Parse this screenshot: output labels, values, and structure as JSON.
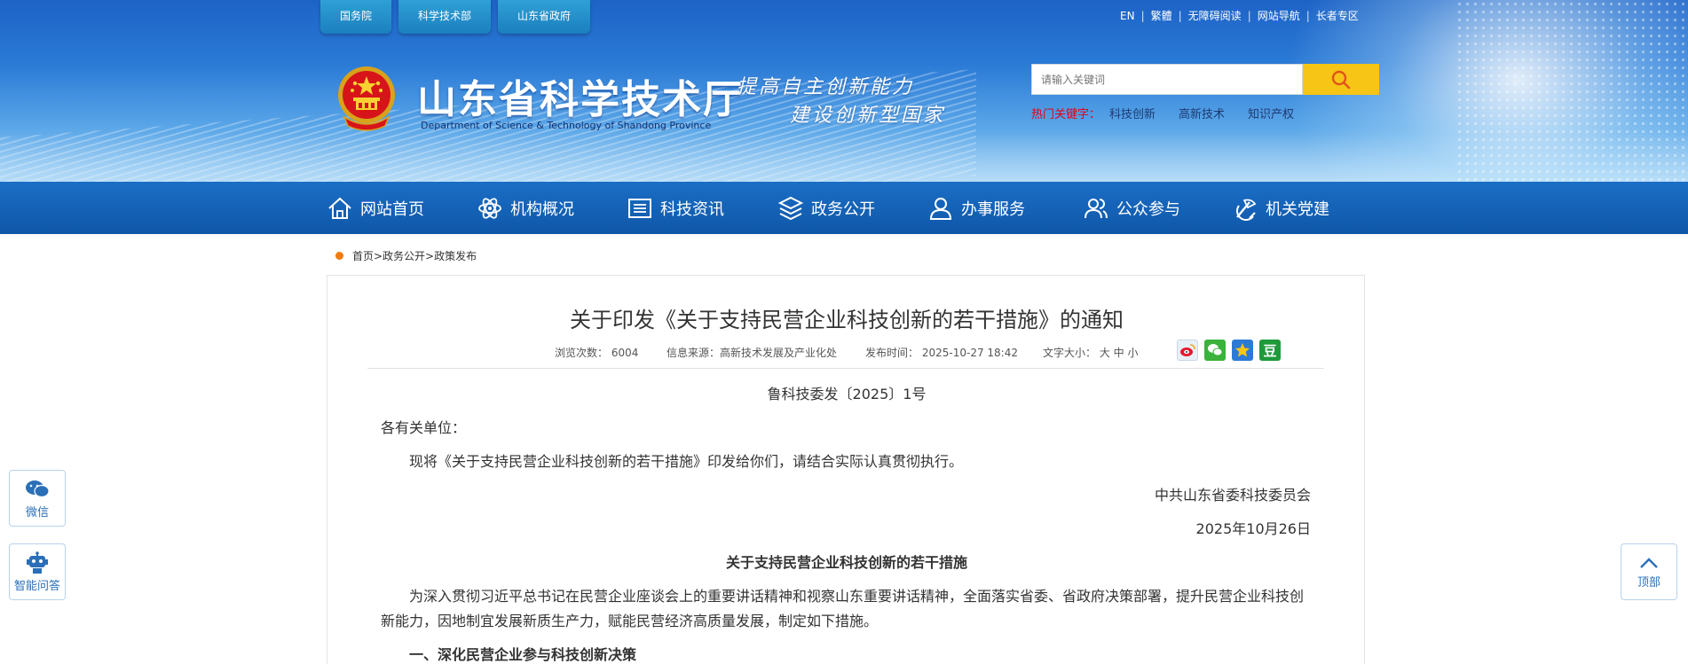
{
  "top_tabs": [
    "国务院",
    "科学技术部",
    "山东省政府"
  ],
  "top_links": [
    "EN",
    "繁體",
    "无障碍阅读",
    "网站导航",
    "长者专区"
  ],
  "site": {
    "title": "山东省科学技术厅",
    "subtitle": "Department of Science & Technology of Shandong Province",
    "slogan_line1": "提高自主创新能力",
    "slogan_line2": "建设创新型国家"
  },
  "search": {
    "placeholder": "请输入关键词",
    "button_icon": "search-icon",
    "hot_label": "热门关键字：",
    "hot_keywords": [
      "科技创新",
      "高新技术",
      "知识产权"
    ]
  },
  "nav": [
    {
      "label": "网站首页",
      "icon": "home-icon"
    },
    {
      "label": "机构概况",
      "icon": "atom-icon"
    },
    {
      "label": "科技资讯",
      "icon": "news-icon"
    },
    {
      "label": "政务公开",
      "icon": "layers-icon"
    },
    {
      "label": "办事服务",
      "icon": "person-icon"
    },
    {
      "label": "公众参与",
      "icon": "people-icon"
    },
    {
      "label": "机关党建",
      "icon": "party-icon"
    }
  ],
  "breadcrumb": "首页>政务公开>政策发布",
  "article": {
    "title": "关于印发《关于支持民营企业科技创新的若干措施》的通知",
    "views_label": "浏览次数：",
    "views": "6004",
    "source_label": "信息来源：",
    "source": "高新技术发展及产业化处",
    "date_label": "发布时间：",
    "date": "2025-10-27 18:42",
    "fontsize_label": "文字大小：",
    "fontsize_opts": "大 中 小",
    "share_icons": [
      "weibo-icon",
      "wechat-icon",
      "qzone-icon",
      "douban-icon"
    ],
    "doc_number": "鲁科技委发〔2025〕1号",
    "salutation": "各有关单位：",
    "intro": "现将《关于支持民营企业科技创新的若干措施》印发给你们，请结合实际认真贯彻执行。",
    "issuer": "中共山东省委科技委员会",
    "issue_date": "2025年10月26日",
    "subtitle": "关于支持民营企业科技创新的若干措施",
    "para1_line1": "为深入贯彻习近平总书记在民营企业座谈会上的重要讲话精神和视察山东重要讲话精神，全面落实省委、省政府决策部署，提升民营企业科技创",
    "para1_line2": "新能力，因地制宜发展新质生产力，赋能民营经济高质量发展，制定如下措施。",
    "section1": "一、深化民营企业参与科技创新决策"
  },
  "floats": {
    "wechat": "微信",
    "qa": "智能问答",
    "top": "顶部"
  }
}
